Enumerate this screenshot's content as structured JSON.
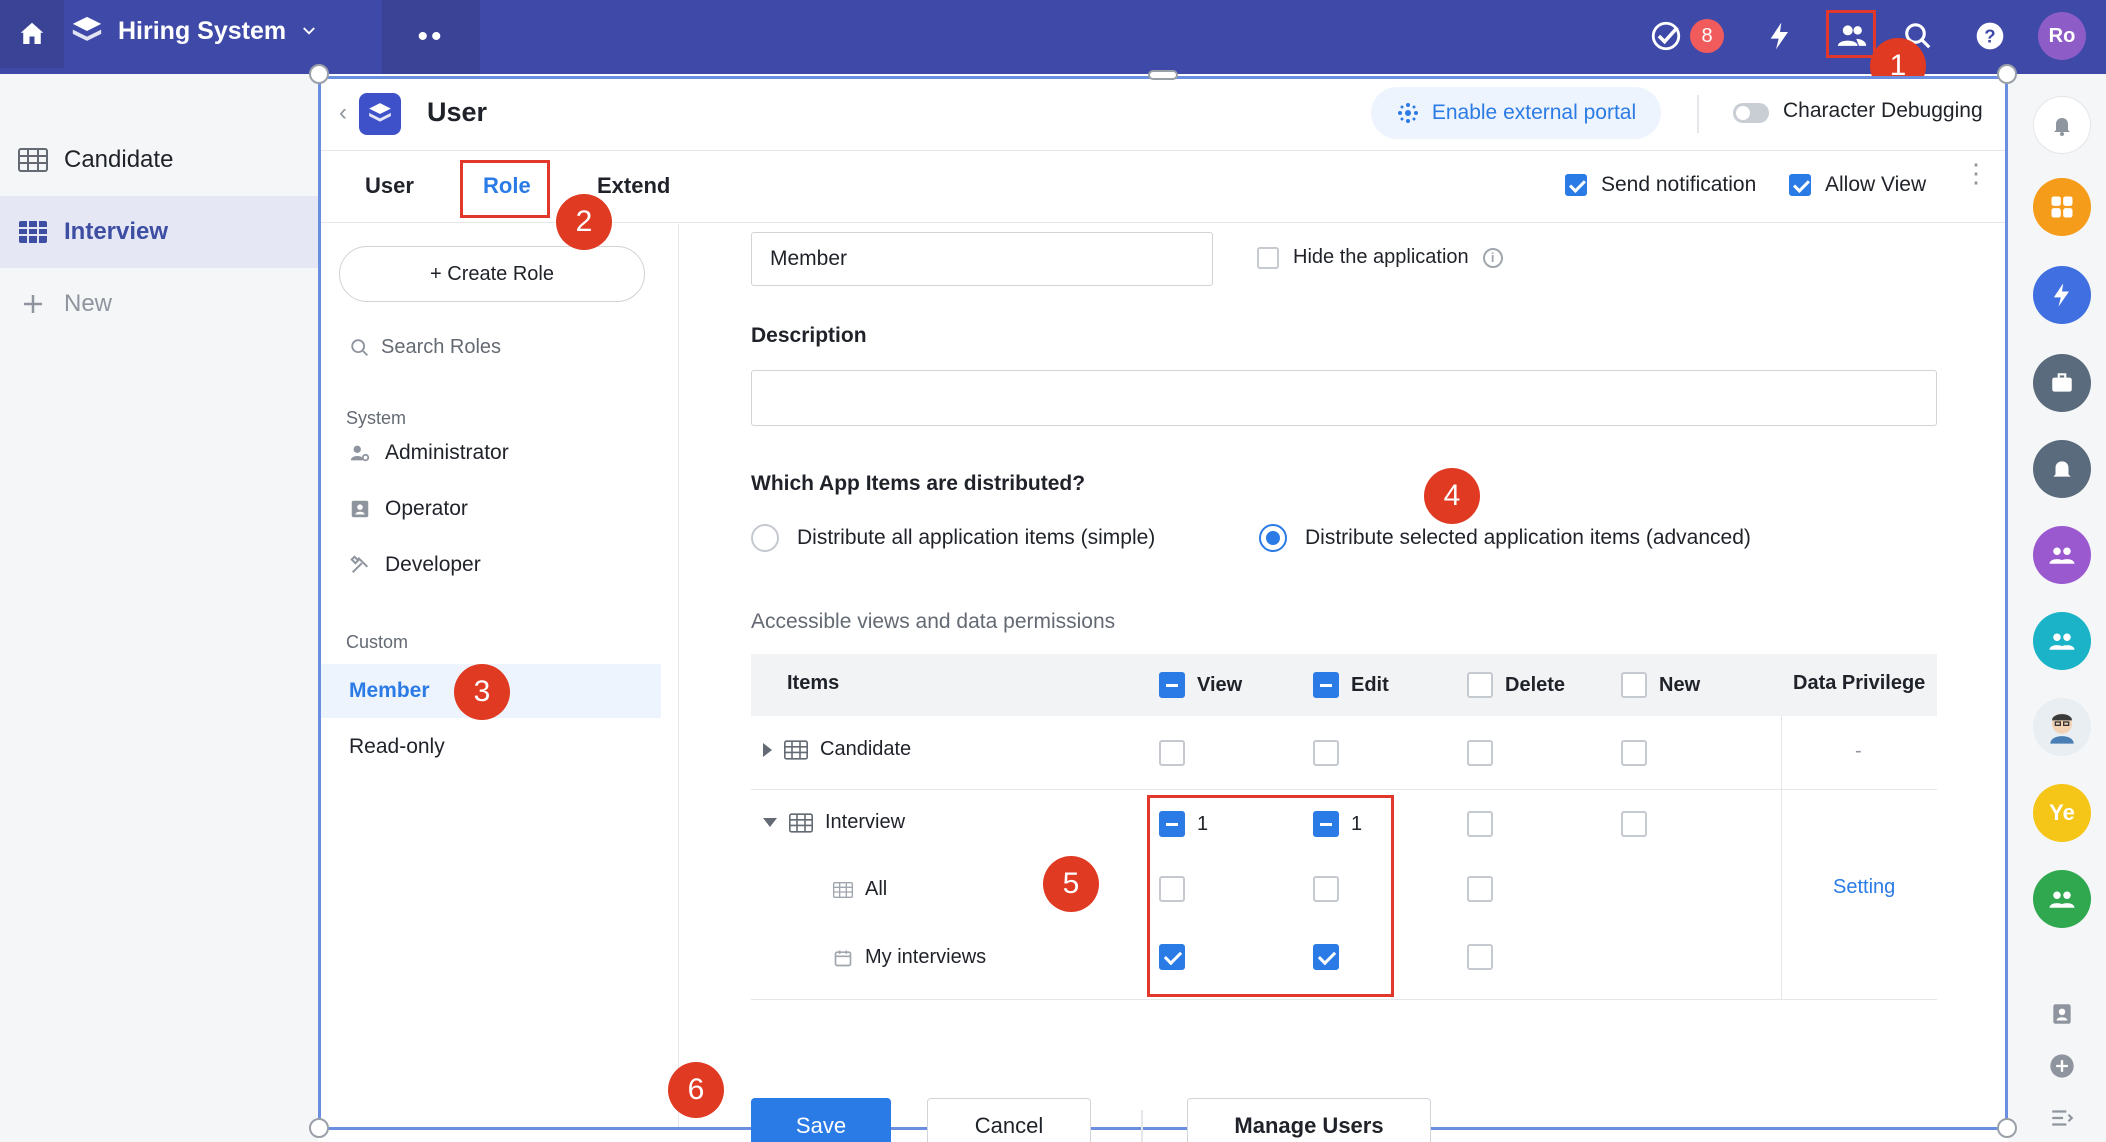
{
  "topbar": {
    "app_name": "Hiring System",
    "badge_count": "8",
    "avatar_initials": "Ro"
  },
  "leftnav": {
    "items": [
      {
        "label": "Candidate",
        "icon": "table-icon"
      },
      {
        "label": "Interview",
        "icon": "table-icon"
      },
      {
        "label": "New",
        "icon": "plus-icon"
      }
    ]
  },
  "dialog": {
    "title": "User",
    "portal_button": "Enable external portal",
    "debug_label": "Character Debugging",
    "tabs": [
      "User",
      "Role",
      "Extend"
    ],
    "active_tab": "Role",
    "send_notification": {
      "label": "Send notification",
      "checked": true
    },
    "allow_view": {
      "label": "Allow View",
      "checked": true
    }
  },
  "roles": {
    "create_label": "+ Create Role",
    "search_placeholder": "Search Roles",
    "system_group": "System",
    "system_roles": [
      "Administrator",
      "Operator",
      "Developer"
    ],
    "custom_group": "Custom",
    "custom_roles": [
      "Member",
      "Read-only"
    ],
    "selected_role": "Member"
  },
  "form": {
    "role_name": "Member",
    "hide_app_label": "Hide the application",
    "description_label": "Description",
    "description_value": "",
    "distribute_question": "Which App Items are distributed?",
    "distribute_simple": "Distribute all application items (simple)",
    "distribute_advanced": "Distribute selected application items (advanced)",
    "distribute_selected": "advanced",
    "permissions_label": "Accessible views and data permissions"
  },
  "permissions": {
    "columns": [
      "Items",
      "View",
      "Edit",
      "Delete",
      "New",
      "Data Privilege"
    ],
    "rows": [
      {
        "name": "Candidate",
        "type": "table",
        "expanded": false,
        "view": "unchecked",
        "edit": "unchecked",
        "delete": "unchecked",
        "new": "unchecked",
        "privilege": "-"
      },
      {
        "name": "Interview",
        "type": "table",
        "expanded": true,
        "view": "partial",
        "view_count": "1",
        "edit": "partial",
        "edit_count": "1",
        "delete": "unchecked",
        "new": "unchecked",
        "privilege": ""
      },
      {
        "name": "All",
        "type": "view",
        "view": "unchecked",
        "edit": "unchecked",
        "delete": "unchecked",
        "privilege": "Setting"
      },
      {
        "name": "My interviews",
        "type": "view",
        "view": "checked",
        "edit": "checked",
        "delete": "unchecked",
        "privilege": ""
      }
    ]
  },
  "buttons": {
    "save": "Save",
    "cancel": "Cancel",
    "manage_users": "Manage Users"
  },
  "annotations": [
    "1",
    "2",
    "3",
    "4",
    "5",
    "6"
  ],
  "rightrail": {
    "avatar_ye": "Ye"
  },
  "colors": {
    "topbar": "#3f4aa8",
    "accent": "#2b7be6",
    "annotation": "#e03a23"
  }
}
